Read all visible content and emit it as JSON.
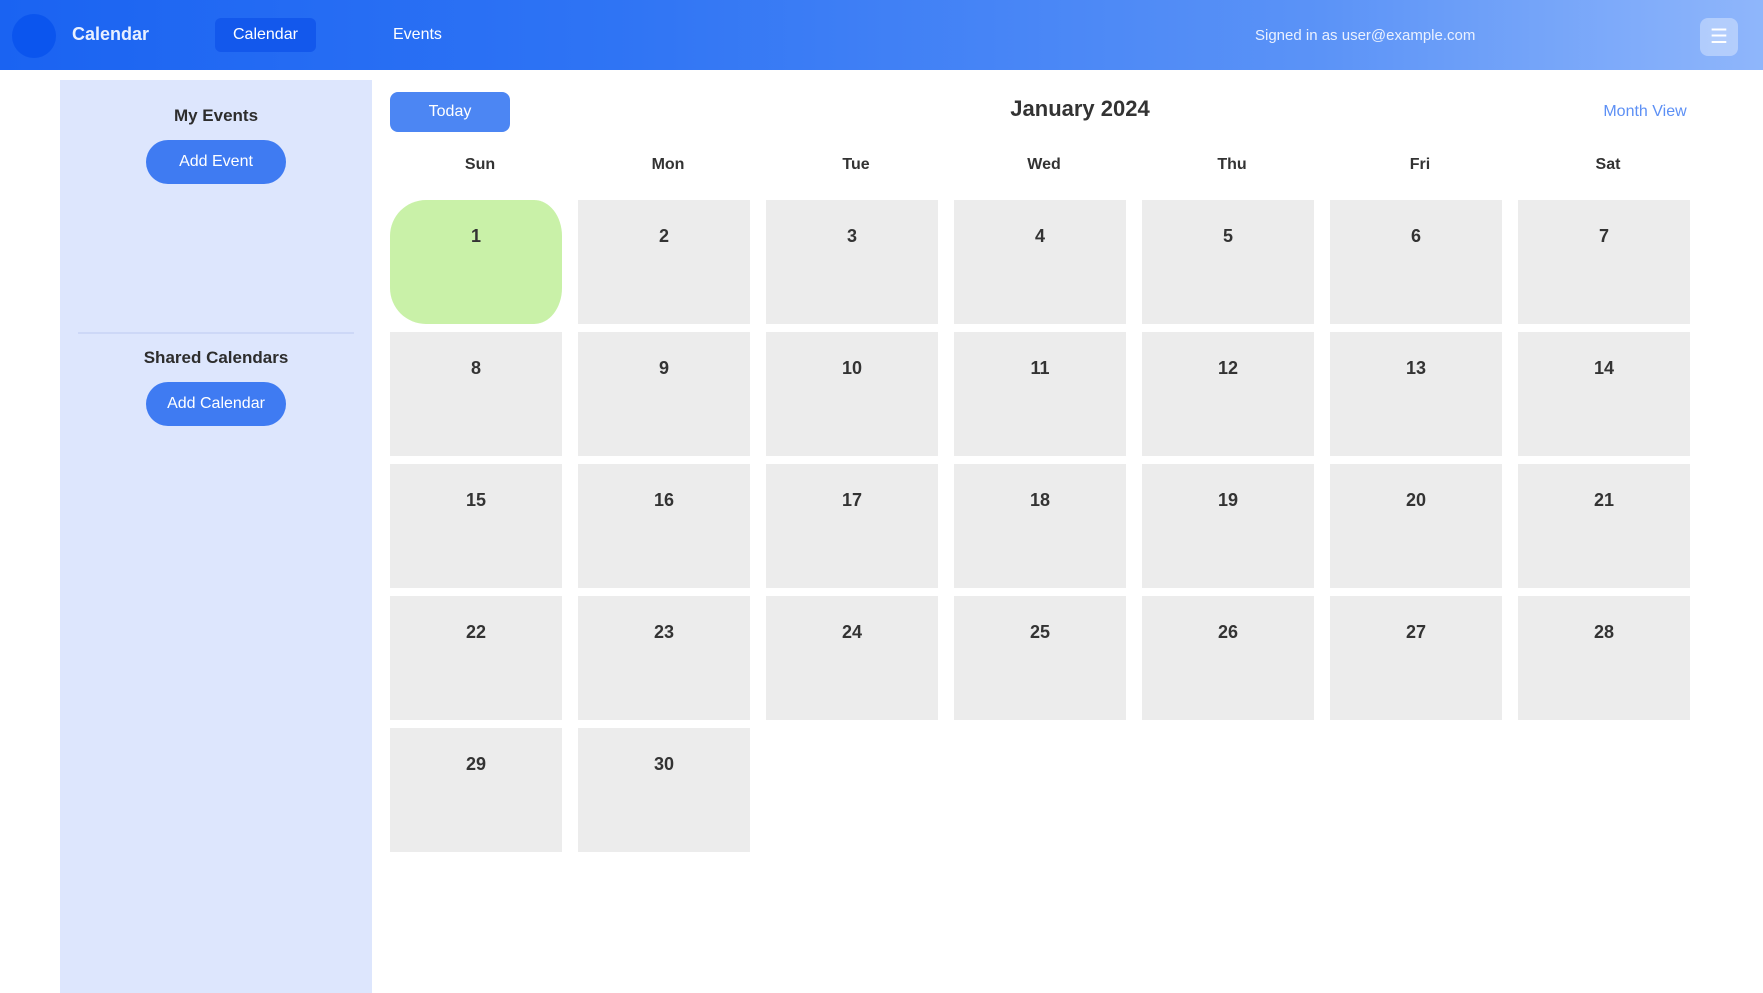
{
  "app": {
    "title": "Calendar"
  },
  "nav": {
    "tabs": [
      "Calendar",
      "Events"
    ],
    "active_tab": 0
  },
  "user": {
    "label": "Signed in as user@example.com"
  },
  "sidebar": {
    "section1": {
      "heading": "My Events",
      "button": "Add Event"
    },
    "section2": {
      "heading": "Shared Calendars",
      "button": "Add Calendar"
    }
  },
  "toolbar": {
    "today_label": "Today",
    "month_title": "January 2024",
    "view_label": "Month View"
  },
  "weekdays": [
    "Sun",
    "Mon",
    "Tue",
    "Wed",
    "Thu",
    "Fri",
    "Sat"
  ],
  "days": [
    "1",
    "2",
    "3",
    "4",
    "5",
    "6",
    "7",
    "8",
    "9",
    "10",
    "11",
    "12",
    "13",
    "14",
    "15",
    "16",
    "17",
    "18",
    "19",
    "20",
    "21",
    "22",
    "23",
    "24",
    "25",
    "26",
    "27",
    "28",
    "29",
    "30"
  ],
  "today_index": 0,
  "colors": {
    "accent": "#3f7bf2",
    "today": "#c9f1a8",
    "sidebar": "#dde6fd",
    "cell": "#ececec"
  },
  "icons": {
    "corner": "menu-icon"
  }
}
